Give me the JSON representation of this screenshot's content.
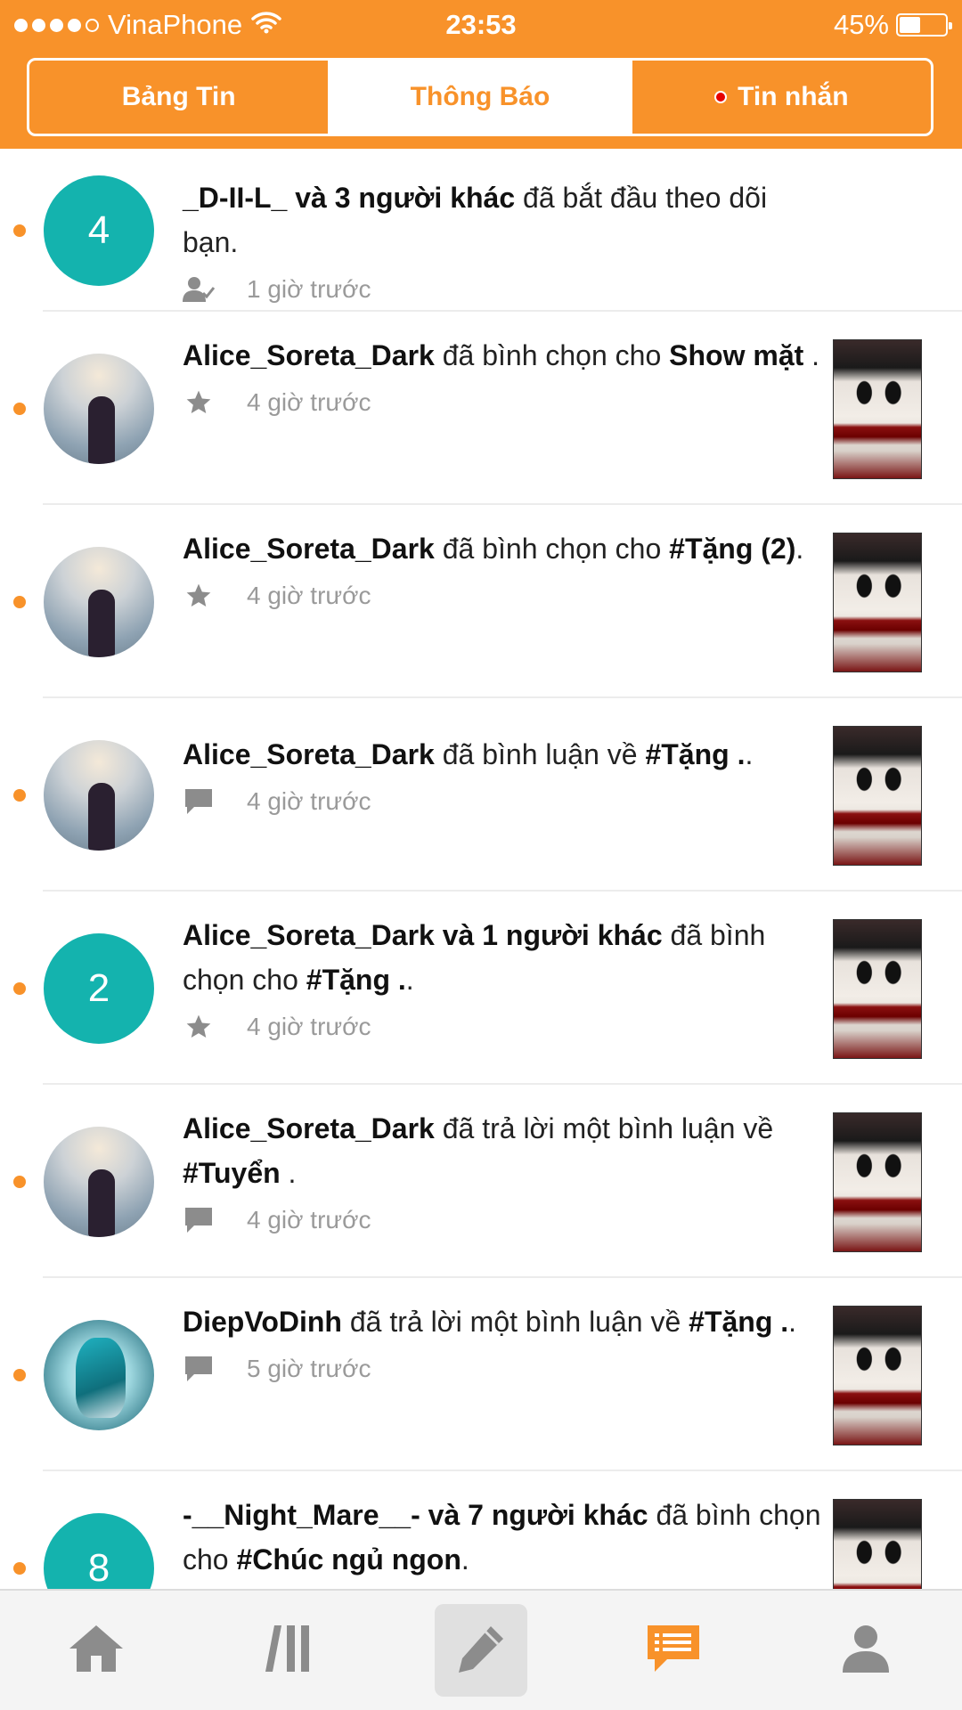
{
  "statusbar": {
    "carrier": "VinaPhone",
    "time": "23:53",
    "battery": "45%",
    "battery_level": 0.45
  },
  "tabs": [
    {
      "label": "Bảng Tin",
      "active": false
    },
    {
      "label": "Thông Báo",
      "active": true
    },
    {
      "label": "Tin nhắn",
      "active": false,
      "has_new": true
    }
  ],
  "notifications": [
    {
      "avatar_count": "4",
      "actor": "_D-II-L_ và 3 người khác",
      "action": " đã bắt đầu theo dõi bạn.",
      "target": "",
      "suffix": "",
      "icon": "follow-icon",
      "time": "1 giờ trước"
    },
    {
      "avatar_count": "",
      "actor": "Alice_Soreta_Dark",
      "action": " đã bình chọn cho ",
      "target": "Show mặt",
      "suffix": " .",
      "icon": "star-icon",
      "time": "4 giờ trước"
    },
    {
      "avatar_count": "",
      "actor": "Alice_Soreta_Dark",
      "action": " đã bình chọn cho ",
      "target": "#Tặng (2)",
      "suffix": ".",
      "icon": "star-icon",
      "time": "4 giờ trước"
    },
    {
      "avatar_count": "",
      "actor": "Alice_Soreta_Dark",
      "action": " đã bình luận về ",
      "target": "#Tặng .",
      "suffix": ".",
      "icon": "comment-icon",
      "time": "4 giờ trước"
    },
    {
      "avatar_count": "2",
      "actor": "Alice_Soreta_Dark và 1 người khác",
      "action": " đã bình chọn cho ",
      "target": "#Tặng .",
      "suffix": ".",
      "icon": "star-icon",
      "time": "4 giờ trước"
    },
    {
      "avatar_count": "",
      "actor": "Alice_Soreta_Dark",
      "action": " đã trả lời một bình luận về ",
      "target": "#Tuyển",
      "suffix": " .",
      "icon": "comment-icon",
      "time": "4 giờ trước"
    },
    {
      "avatar_count": "",
      "actor": "DiepVoDinh",
      "action": " đã trả lời một bình luận về ",
      "target": "#Tặng .",
      "suffix": ".",
      "icon": "comment-icon",
      "time": "5 giờ trước"
    },
    {
      "avatar_count": "8",
      "actor": "-__Night_Mare__- và 7 người khác",
      "action": " đã bình chọn cho ",
      "target": "#Chúc ngủ ngon",
      "suffix": ".",
      "icon": "star-icon",
      "time": ""
    }
  ],
  "tabbar": [
    {
      "icon": "home-icon",
      "active": false
    },
    {
      "icon": "library-icon",
      "active": false
    },
    {
      "icon": "pencil-icon",
      "active": false
    },
    {
      "icon": "notification-chat-icon",
      "active": true
    },
    {
      "icon": "profile-icon",
      "active": false
    }
  ],
  "colors": {
    "brand": "#F8922A",
    "teal": "#14B3AE",
    "inactive_icon": "#8c8c8c",
    "unread_dot": "#F8922A",
    "new_message_dot": "#E60000"
  }
}
